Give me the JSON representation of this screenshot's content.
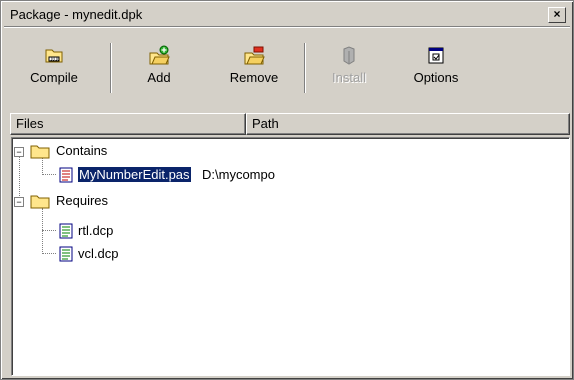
{
  "window": {
    "title": "Package - mynedit.dpk",
    "close_label": "×"
  },
  "toolbar": {
    "compile_label": "Compile",
    "add_label": "Add",
    "remove_label": "Remove",
    "install_label": "Install",
    "options_label": "Options"
  },
  "columns": {
    "files": "Files",
    "path": "Path"
  },
  "tree": {
    "contains": {
      "label": "Contains",
      "expander": "−",
      "items": [
        {
          "name": "MyNumberEdit.pas",
          "path": "D:\\mycompo"
        }
      ]
    },
    "requires": {
      "label": "Requires",
      "expander": "−",
      "items": [
        {
          "name": "rtl.dcp"
        },
        {
          "name": "vcl.dcp"
        }
      ]
    }
  },
  "colors": {
    "selection": "#0a246a",
    "face": "#d4d0c8"
  }
}
